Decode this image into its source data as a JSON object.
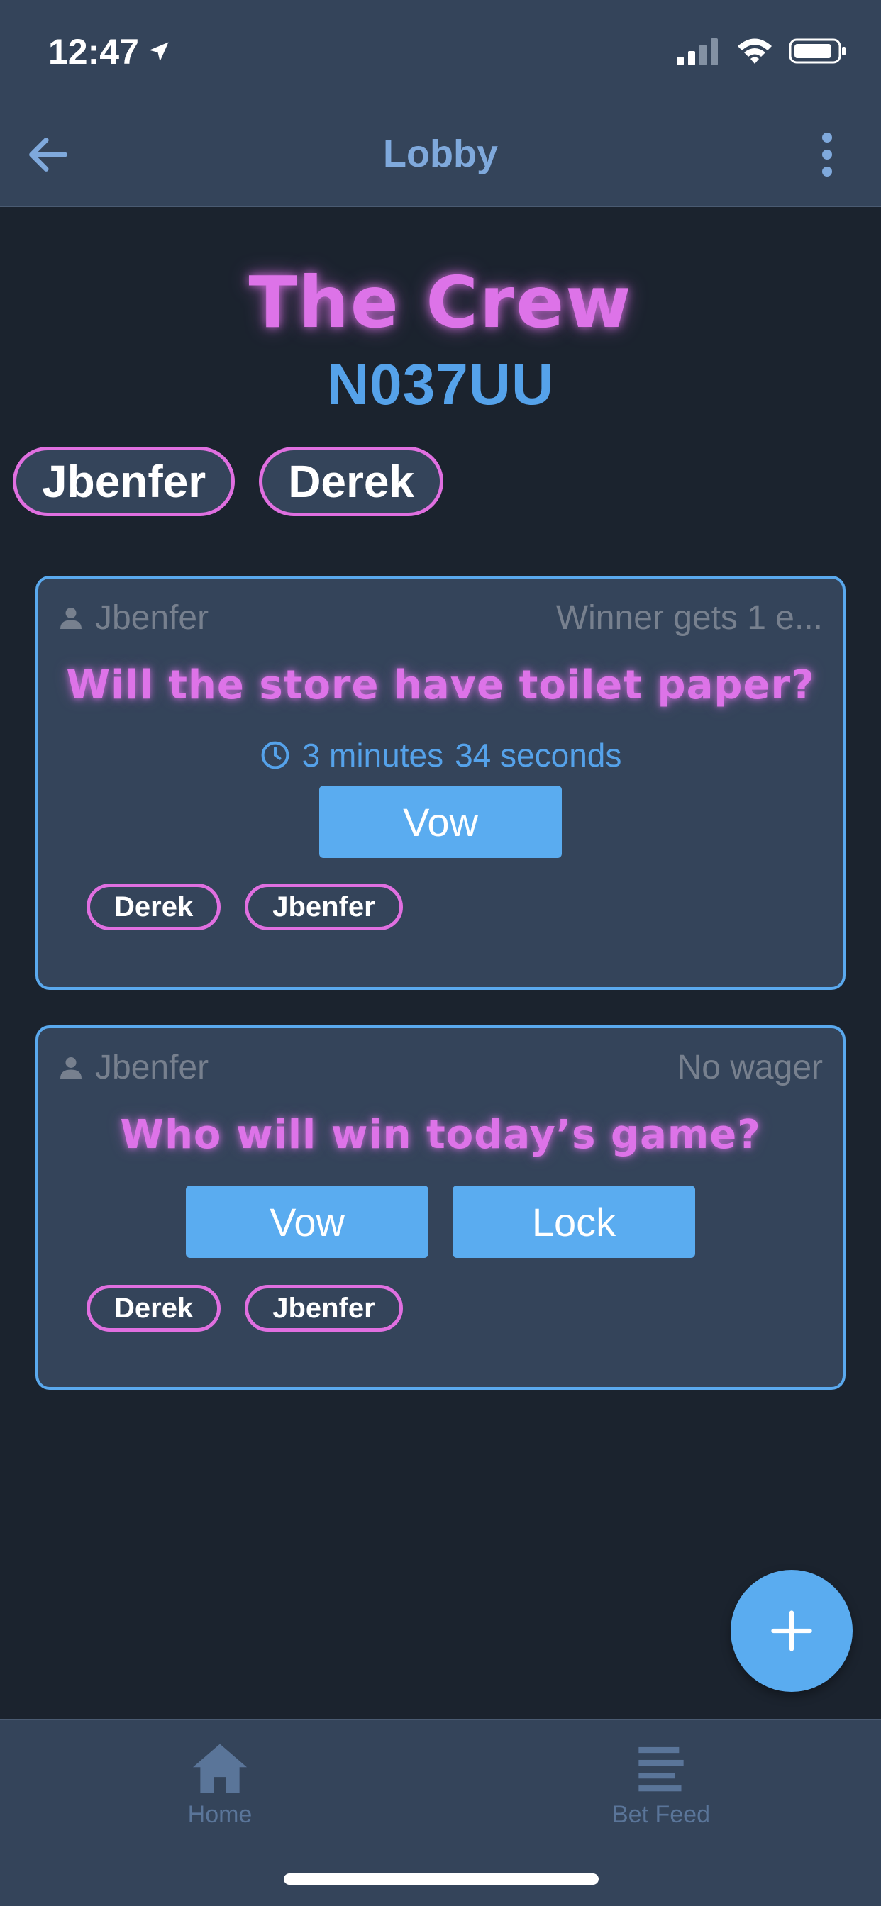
{
  "status_bar": {
    "time": "12:47"
  },
  "app_bar": {
    "title": "Lobby"
  },
  "group": {
    "name": "The Crew",
    "code": "N037UU"
  },
  "members": [
    "Jbenfer",
    "Derek"
  ],
  "bets": [
    {
      "author": "Jbenfer",
      "wager": "Winner gets 1 e...",
      "question": "Will the store have toilet paper?",
      "timer": {
        "minutes": "3 minutes",
        "seconds": "34 seconds"
      },
      "actions": [
        "Vow"
      ],
      "participants": [
        "Derek",
        "Jbenfer"
      ]
    },
    {
      "author": "Jbenfer",
      "wager": "No wager",
      "question": "Who will win today’s game?",
      "actions": [
        "Vow",
        "Lock"
      ],
      "participants": [
        "Derek",
        "Jbenfer"
      ]
    }
  ],
  "fab": {
    "icon": "plus-icon"
  },
  "tabs": [
    {
      "label": "Home",
      "icon": "home-icon"
    },
    {
      "label": "Bet Feed",
      "icon": "list-icon"
    }
  ],
  "colors": {
    "accent_pink": "#dd73e8",
    "accent_blue": "#5aacf0",
    "surface": "#34445a",
    "background": "#1b232e"
  }
}
